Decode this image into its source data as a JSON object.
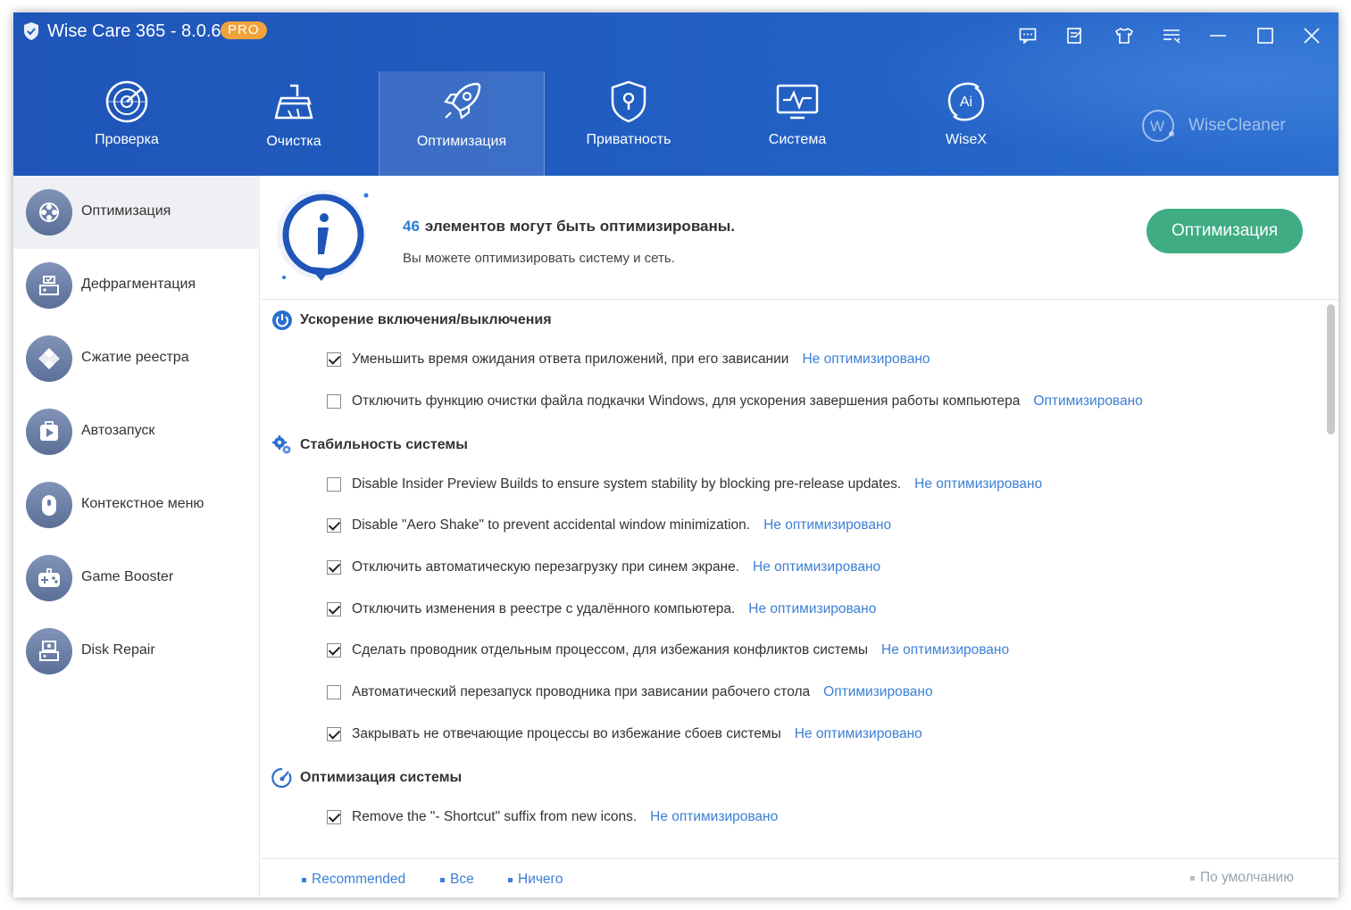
{
  "app": {
    "title": "Wise Care 365 - 8.0.6",
    "badge": "PRO",
    "brand": "WiseCleaner"
  },
  "window_controls": [
    "feedback-icon",
    "notes-icon",
    "shirt-icon",
    "menu-icon",
    "minimize-icon",
    "maximize-icon",
    "close-icon"
  ],
  "nav": {
    "items": [
      {
        "label": "Проверка",
        "icon": "radar-icon"
      },
      {
        "label": "Очистка",
        "icon": "broom-icon"
      },
      {
        "label": "Оптимизация",
        "icon": "rocket-icon",
        "active": true
      },
      {
        "label": "Приватность",
        "icon": "shield-lock-icon"
      },
      {
        "label": "Система",
        "icon": "monitor-pulse-icon"
      },
      {
        "label": "WiseX",
        "icon": "ai-icon"
      }
    ]
  },
  "sidebar": {
    "items": [
      {
        "label": "Оптимизация",
        "icon": "gear-flower-icon",
        "active": true
      },
      {
        "label": "Дефрагментация",
        "icon": "disk-defrag-icon"
      },
      {
        "label": "Сжатие реестра",
        "icon": "registry-icon"
      },
      {
        "label": "Автозапуск",
        "icon": "play-icon"
      },
      {
        "label": "Контекстное меню",
        "icon": "mouse-icon"
      },
      {
        "label": "Game Booster",
        "icon": "gamepad-icon"
      },
      {
        "label": "Disk Repair",
        "icon": "disk-repair-icon"
      }
    ]
  },
  "banner": {
    "count": "46",
    "headline": "элементов могут быть оптимизированы.",
    "subtitle": "Вы можете оптимизировать систему и сеть.",
    "button": "Оптимизация"
  },
  "sections": [
    {
      "title": "Ускорение включения/выключения",
      "icon": "power-icon",
      "items": [
        {
          "text": "Уменьшить время ожидания ответа приложений, при его зависании",
          "status": "Не оптимизировано",
          "checked": true
        },
        {
          "text": "Отключить функцию очистки файла подкачки Windows, для ускорения завершения работы компьютера",
          "status": "Оптимизировано",
          "checked": false
        }
      ]
    },
    {
      "title": "Стабильность системы",
      "icon": "gears-icon",
      "items": [
        {
          "text": "Disable Insider Preview Builds to ensure system stability by blocking pre-release updates.",
          "status": "Не оптимизировано",
          "checked": false
        },
        {
          "text": "Disable \"Aero Shake\" to prevent accidental window minimization.",
          "status": "Не оптимизировано",
          "checked": true
        },
        {
          "text": "Отключить автоматическую перезагрузку при синем экране.",
          "status": "Не оптимизировано",
          "checked": true
        },
        {
          "text": "Отключить изменения в реестре с удалённого компьютера.",
          "status": "Не оптимизировано",
          "checked": true
        },
        {
          "text": "Сделать проводник отдельным процессом, для избежания конфликтов системы",
          "status": "Не оптимизировано",
          "checked": true
        },
        {
          "text": "Автоматический перезапуск проводника при зависании рабочего стола",
          "status": "Оптимизировано",
          "checked": false
        },
        {
          "text": "Закрывать не отвечающие процессы во избежание сбоев системы",
          "status": "Не оптимизировано",
          "checked": true
        }
      ]
    },
    {
      "title": "Оптимизация системы",
      "icon": "speedometer-icon",
      "items": [
        {
          "text": "Remove the \"- Shortcut\" suffix from new icons.",
          "status": "Не оптимизировано",
          "checked": true
        }
      ]
    }
  ],
  "footer": {
    "recommended": "Recommended",
    "all": "Все",
    "none": "Ничего",
    "default": "По умолчанию"
  },
  "colors": {
    "header": "#2260c4",
    "accent_green": "#3fac84",
    "link_blue": "#3b7fd4",
    "pro_badge": "#f0a33a"
  }
}
